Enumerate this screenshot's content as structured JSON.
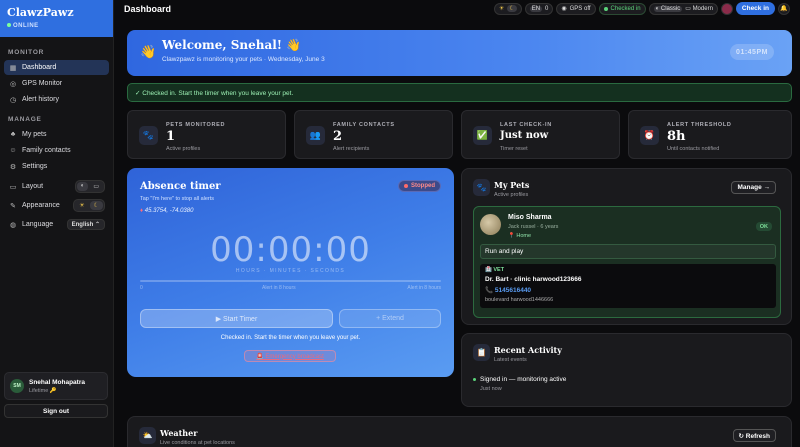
{
  "brand": {
    "name": "ClawzPawz",
    "status": "ONLINE"
  },
  "sidebar": {
    "monitor_label": "MONITOR",
    "monitor_items": [
      {
        "label": "Dashboard",
        "icon": "grid-icon"
      },
      {
        "label": "GPS Monitor",
        "icon": "gps-icon"
      },
      {
        "label": "Alert history",
        "icon": "history-icon"
      }
    ],
    "manage_label": "MANAGE",
    "manage_items": [
      {
        "label": "My pets",
        "icon": "paw-icon"
      },
      {
        "label": "Family contacts",
        "icon": "people-icon"
      },
      {
        "label": "Settings",
        "icon": "gear-icon"
      }
    ],
    "layout_label": "Layout",
    "appearance_label": "Appearance",
    "language_label": "Language",
    "language_value": "English ⌃"
  },
  "user": {
    "initials": "SM",
    "name": "Snehal Mohapatra",
    "plan": "Lifetime 🔑",
    "signout": "Sign out"
  },
  "header": {
    "title": "Dashboard",
    "lang": "EN",
    "lang_count": "0",
    "gps": "GPS off",
    "checked": "Checked in",
    "classic": "Classic",
    "modern": "Modern",
    "checkin_btn": "Check in"
  },
  "welcome": {
    "title": "Welcome, Snehal! 👋",
    "subtitle": "Clawzpawz is monitoring your pets · Wednesday, June 3",
    "time": "01:45PM",
    "wave": "👋"
  },
  "banner": "✓ Checked in. Start the timer when you leave your pet.",
  "stats": [
    {
      "label": "PETS MONITORED",
      "value": "1",
      "note": "Active profiles",
      "icon": "🐾"
    },
    {
      "label": "FAMILY CONTACTS",
      "value": "2",
      "note": "Alert recipients",
      "icon": "👥"
    },
    {
      "label": "LAST CHECK-IN",
      "value": "Just now",
      "note": "Timer reset",
      "icon": "✅"
    },
    {
      "label": "ALERT THRESHOLD",
      "value": "8h",
      "note": "Until contacts notified",
      "icon": "⏰"
    }
  ],
  "timer": {
    "title": "Absence timer",
    "hint": "Tap \"I'm here\" to stop all alerts",
    "coords": "45.3754, -74.0380",
    "state": "Stopped",
    "display": "00:00:00",
    "units": "HOURS · MINUTES · SECONDS",
    "progress": 0,
    "track_start": "0",
    "track_mid": "Alert in 8 hours",
    "track_end": "Alert in 8 hours",
    "start_btn": "▶ Start Timer",
    "extend_btn": "+ Extend",
    "status": "Checked in. Start the timer when you leave your pet.",
    "emergency": "🚨 Emergency broadcast"
  },
  "pets": {
    "title": "My Pets",
    "subtitle": "Active profiles",
    "manage": "Manage →",
    "pet": {
      "name": "Miso Sharma",
      "breed": "Jack russel · 6 years",
      "location": "📍 Home",
      "status": "OK",
      "note": "Run and play",
      "vet_label": "🏥 VET",
      "vet_name": "Dr. Bart · clinic harwood123666",
      "vet_phone": "📞 5145616440",
      "vet_address": "boulevard harwood1446666"
    }
  },
  "activity": {
    "title": "Recent Activity",
    "subtitle": "Latest events",
    "items": [
      {
        "text": "Signed in — monitoring active",
        "time": "Just now"
      }
    ]
  },
  "weather": {
    "title": "Weather",
    "subtitle": "Live conditions at pet locations",
    "refresh": "↻ Refresh"
  }
}
